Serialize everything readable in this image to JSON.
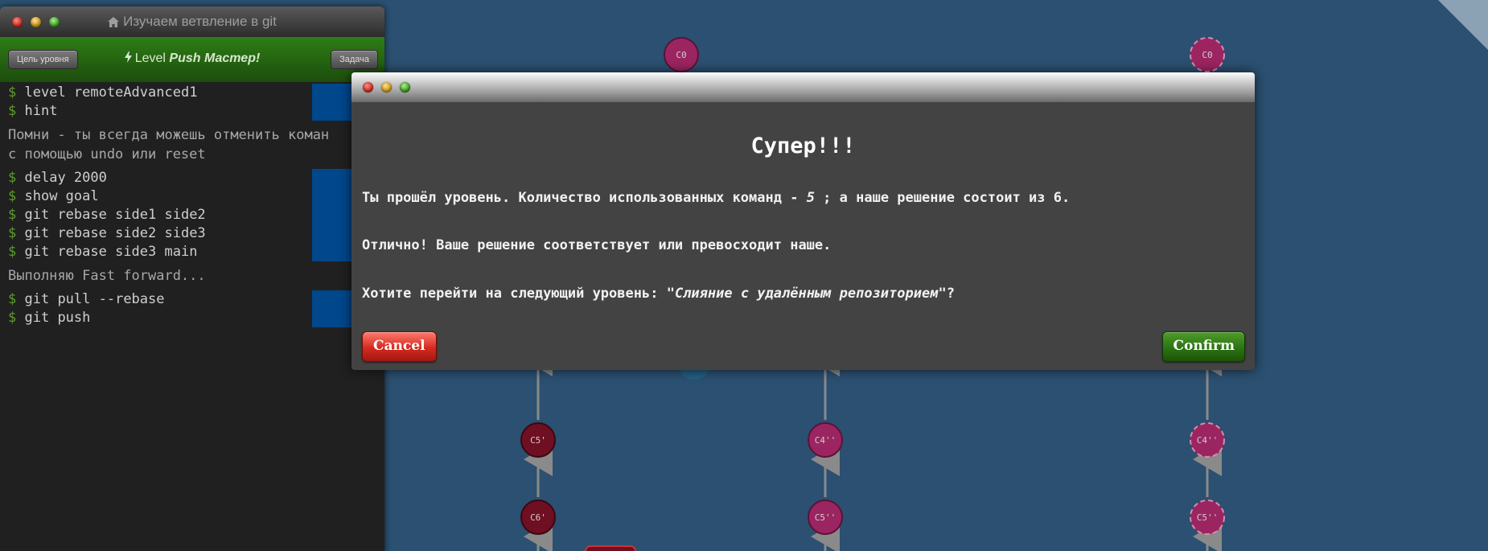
{
  "terminal": {
    "title": "Изучаем ветвление в git",
    "goal_button": "Цель уровня",
    "task_button": "Задача",
    "level_prefix": "Level",
    "level_name": "Push Мастер!",
    "blocks": [
      {
        "lines": [
          "level remoteAdvanced1",
          "hint"
        ]
      },
      {
        "message": [
          "Помни - ты всегда можешь отменить коман",
          "с помощью undo или reset"
        ]
      },
      {
        "lines": [
          "delay 2000",
          "show goal",
          "git rebase side1 side2",
          "git rebase side2 side3",
          "git rebase side3 main"
        ]
      },
      {
        "message": [
          "Выполняю Fast forward..."
        ]
      },
      {
        "lines": [
          "git pull --rebase",
          "git push"
        ]
      }
    ],
    "prompt": "$"
  },
  "graph": {
    "commits": [
      {
        "label": "C0",
        "style": "magenta-solid"
      },
      {
        "label": "C0",
        "style": "magenta-dashed"
      },
      {
        "label": "C5'",
        "style": "dark-red"
      },
      {
        "label": "C6'",
        "style": "dark-red"
      },
      {
        "label": "C4''",
        "style": "magenta-solid"
      },
      {
        "label": "C5''",
        "style": "magenta-solid"
      },
      {
        "label": "C4''",
        "style": "magenta-dashed"
      },
      {
        "label": "C5''",
        "style": "magenta-dashed"
      }
    ],
    "colors": {
      "background": "#2b5071",
      "magenta": "#9b2561",
      "dark_red": "#6e0f22",
      "edge": "#8a8a8a"
    }
  },
  "modal": {
    "heading": "Супер!!!",
    "p1_before": "Ты прошёл уровень. Количество использованных команд - ",
    "p1_count": "5",
    "p1_after": " ; а наше решение состоит из 6.",
    "p2": "Отлично! Ваше решение соответствует или превосходит наше.",
    "p3_before": "Хотите перейти на следующий уровень: ",
    "p3_level": "\"Слияние с удалённым репозиторием\"",
    "p3_after": "?",
    "cancel": "Cancel",
    "confirm": "Confirm"
  }
}
